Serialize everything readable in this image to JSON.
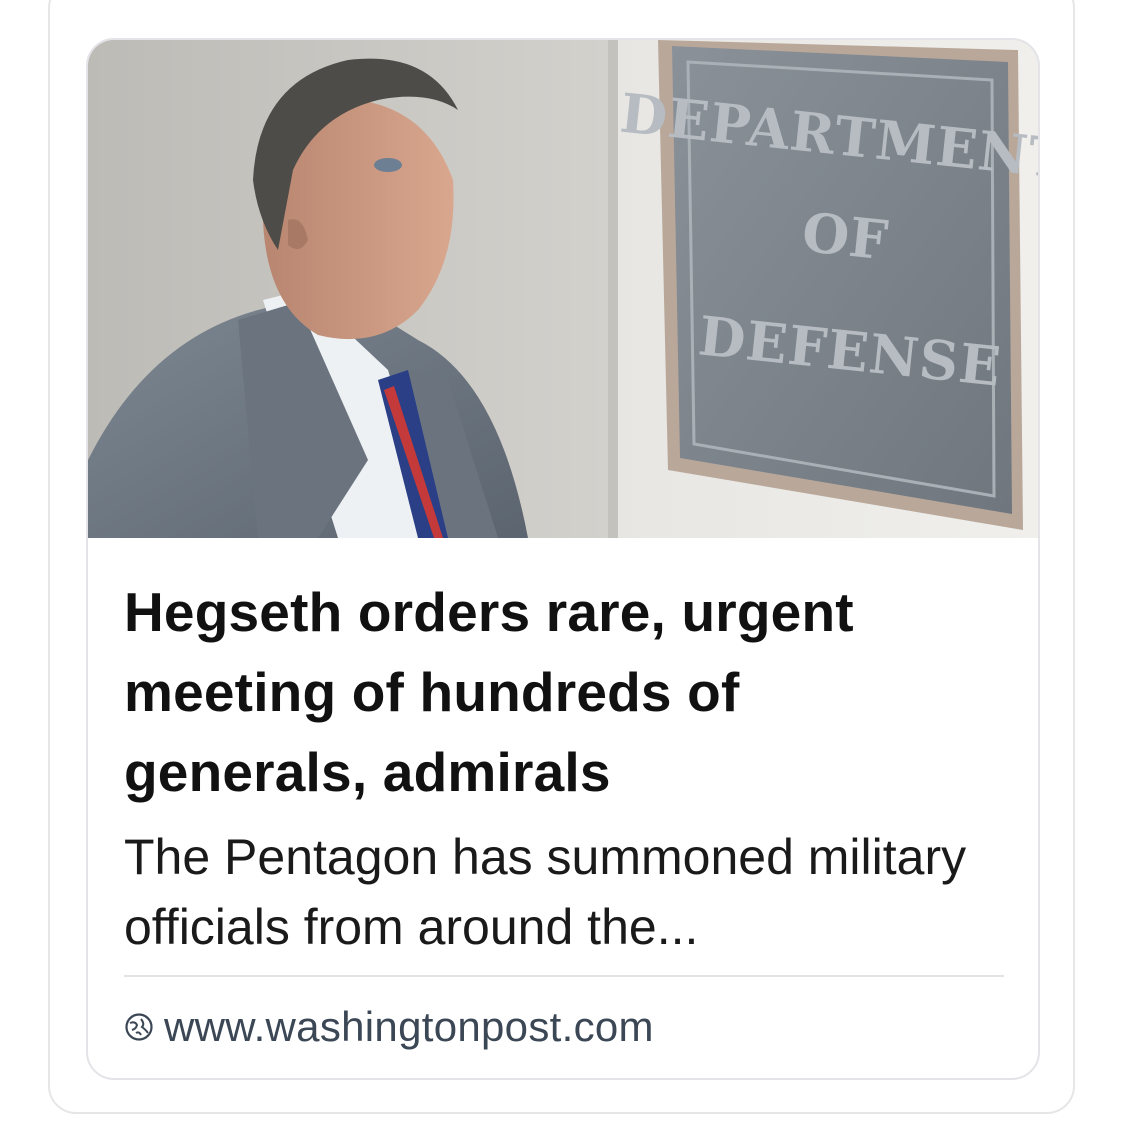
{
  "hero_image": {
    "alt": "",
    "sign_text": [
      "DEPARTMENT",
      "OF",
      "DEFENSE"
    ]
  },
  "article": {
    "headline": "Hegseth orders rare, urgent meeting of hundreds of generals, admirals",
    "summary": "The Pentagon has summoned military officials from around the...",
    "source_url": "www.washingtonpost.com"
  },
  "colors": {
    "headline": "#111111",
    "source": "#3b4755",
    "border": "#e4e4e8"
  },
  "icons": {
    "source": "globe-icon"
  }
}
